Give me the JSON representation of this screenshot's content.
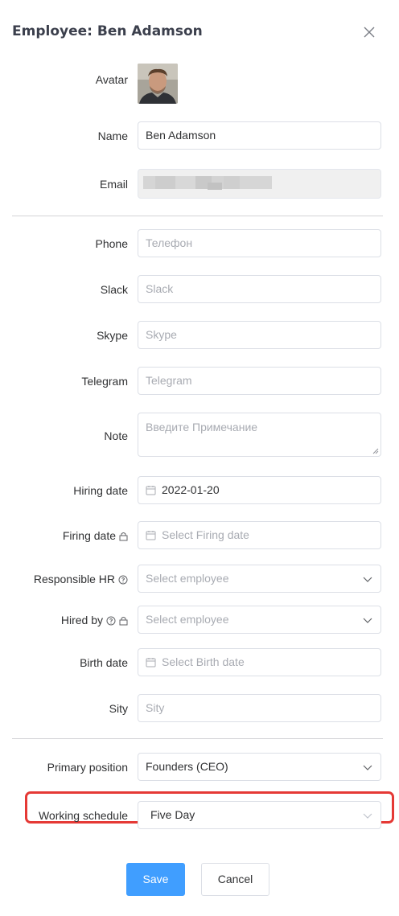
{
  "dialog": {
    "title": "Employee: Ben Adamson"
  },
  "icons": {
    "close": "close-icon",
    "calendar": "calendar-icon",
    "chevron": "chevron-down-icon",
    "lock": "lock-icon",
    "help": "question-circle-icon"
  },
  "colors": {
    "primary": "#409eff",
    "highlight": "#e53935",
    "border": "#dcdfe6",
    "placeholder": "#a8abb2"
  },
  "fields": {
    "avatar": {
      "label": "Avatar"
    },
    "name": {
      "label": "Name",
      "value": "Ben Adamson"
    },
    "email": {
      "label": "Email"
    },
    "phone": {
      "label": "Phone",
      "placeholder": "Телефон"
    },
    "slack": {
      "label": "Slack",
      "placeholder": "Slack"
    },
    "skype": {
      "label": "Skype",
      "placeholder": "Skype"
    },
    "telegram": {
      "label": "Telegram",
      "placeholder": "Telegram"
    },
    "note": {
      "label": "Note",
      "placeholder": "Введите Примечание"
    },
    "hiring_date": {
      "label": "Hiring date",
      "value": "2022-01-20"
    },
    "firing_date": {
      "label": "Firing date",
      "placeholder": "Select Firing date"
    },
    "responsible_hr": {
      "label": "Responsible HR",
      "placeholder": "Select employee"
    },
    "hired_by": {
      "label": "Hired by",
      "placeholder": "Select employee"
    },
    "birth_date": {
      "label": "Birth date",
      "placeholder": "Select Birth date"
    },
    "sity": {
      "label": "Sity",
      "placeholder": "Sity"
    },
    "primary_position": {
      "label": "Primary position",
      "value": "Founders (CEO)"
    },
    "working_schedule": {
      "label": "Working schedule",
      "value": "Five Day"
    }
  },
  "buttons": {
    "save": "Save",
    "cancel": "Cancel"
  }
}
